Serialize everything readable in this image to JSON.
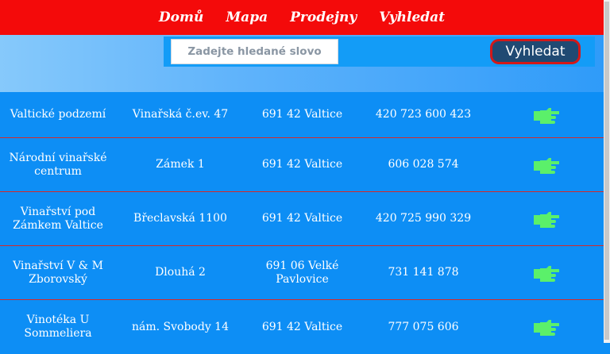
{
  "nav": {
    "items": [
      {
        "label": "Domů"
      },
      {
        "label": "Mapa"
      },
      {
        "label": "Prodejny"
      },
      {
        "label": "Vyhledat"
      }
    ]
  },
  "search": {
    "placeholder": "Zadejte hledané slovo",
    "button_label": "Vyhledat"
  },
  "rows": [
    {
      "name": "Valtické podzemí",
      "address": "Vinařská č.ev. 47",
      "city": "691 42 Valtice",
      "phone": "420 723 600 423",
      "icon": "pointing-hand-icon"
    },
    {
      "name": "Národní vinařské centrum",
      "address": "Zámek 1",
      "city": "691 42 Valtice",
      "phone": "606 028 574",
      "icon": "pointing-hand-icon"
    },
    {
      "name": "Vinařství pod Zámkem Valtice",
      "address": "Břeclavská 1100",
      "city": "691 42 Valtice",
      "phone": "420 725 990 329",
      "icon": "pointing-hand-icon"
    },
    {
      "name": "Vinařství V & M Zborovský",
      "address": "Dlouhá 2",
      "city": "691 06 Velké Pavlovice",
      "phone": "731 141 878",
      "icon": "pointing-hand-icon"
    },
    {
      "name": "Vinotéka U Sommeliera",
      "address": "nám. Svobody 14",
      "city": "691 42 Valtice",
      "phone": "777 075 606",
      "icon": "pointing-hand-icon"
    }
  ],
  "colors": {
    "nav_bg": "#f40a0a",
    "page_bg": "#0d8ef5",
    "row_divider": "#d42a2a",
    "icon_green": "#5bf06a",
    "button_bg": "#204a73"
  }
}
